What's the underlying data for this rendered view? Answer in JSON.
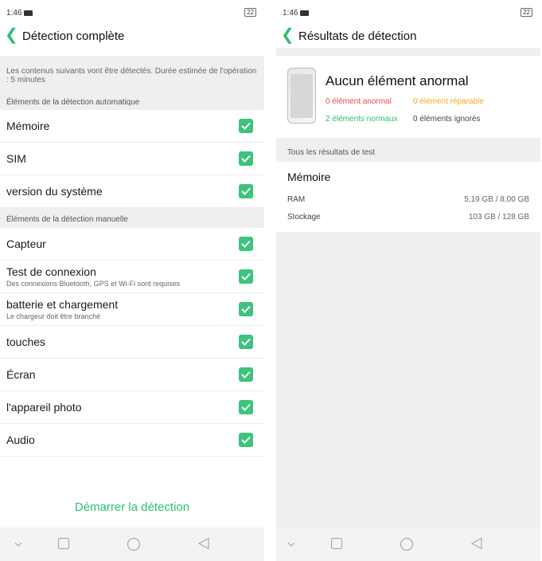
{
  "left": {
    "time": "1:46",
    "battery": "22",
    "title": "Détection complète",
    "intro": "Les contenus suivants vont être détectés. Durée estimée de l'opération : 5 minutes",
    "auto_section": "Éléments de la détection automatique",
    "auto_items": [
      {
        "label": "Mémoire",
        "checked": true
      },
      {
        "label": "SIM",
        "checked": true
      },
      {
        "label": "version du système",
        "checked": true
      }
    ],
    "manual_section": "Éléments de la détection manuelle",
    "manual_items": [
      {
        "label": "Capteur",
        "sub": "",
        "checked": true
      },
      {
        "label": "Test de connexion",
        "sub": "Des connexions Bluetooth, GPS et Wi-Fi sont requises",
        "checked": true
      },
      {
        "label": "batterie et chargement",
        "sub": "Le chargeur doit être branché",
        "checked": true
      },
      {
        "label": "touches",
        "sub": "",
        "checked": true
      },
      {
        "label": "Écran",
        "sub": "",
        "checked": true
      },
      {
        "label": "l'appareil photo",
        "sub": "",
        "checked": true
      },
      {
        "label": "Audio",
        "sub": "",
        "checked": true
      }
    ],
    "start_button": "Démarrer la détection"
  },
  "right": {
    "time": "1:46",
    "battery": "22",
    "title": "Résultats de détection",
    "result_title": "Aucun élément anormal",
    "abnormal": "0 élément anormal",
    "repairable": "0 élément réparable",
    "normal": "2 éléments normaux",
    "ignored": "0 éléments ignorés",
    "all_results_label": "Tous les résultats de test",
    "memory_title": "Mémoire",
    "ram_label": "RAM",
    "ram_value": "5,19 GB / 8,00 GB",
    "storage_label": "Stockage",
    "storage_value": "103 GB / 128 GB"
  },
  "colors": {
    "accent": "#2fbf71",
    "check": "#3cc47d",
    "abnormal": "#f04848",
    "repairable": "#f5a623",
    "normal": "#2fbf71"
  },
  "icons": [
    "back-chevron-icon",
    "checkmark-icon",
    "nav-down-icon",
    "nav-square-icon",
    "nav-circle-icon",
    "nav-back-triangle-icon",
    "notification-icon",
    "battery-icon"
  ]
}
